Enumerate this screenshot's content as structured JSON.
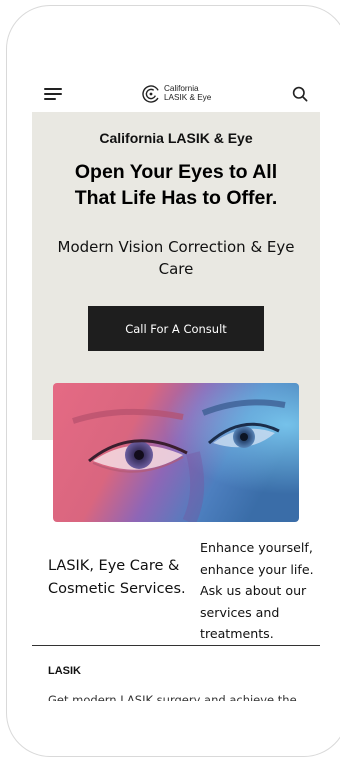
{
  "header": {
    "logo_line1": "California",
    "logo_line2": "LASIK & Eye",
    "menu_icon": "hamburger-menu-icon",
    "search_icon": "search-icon"
  },
  "hero": {
    "brand": "California LASIK & Eye",
    "headline": "Open Your Eyes to All That Life Has to Offer.",
    "subline": "Modern Vision Correction & Eye Care",
    "cta_label": "Call For A Consult",
    "background_color": "#e9e8e2",
    "cta_color": "#1e1e1e"
  },
  "intro": {
    "tagline": "LASIK, Eye Care & Cosmetic Services.",
    "blurb": "Enhance yourself, enhance your life. Ask us about our services and treatments."
  },
  "services": [
    {
      "title": "LASIK",
      "description": "Get modern LASIK surgery and achieve the"
    }
  ]
}
